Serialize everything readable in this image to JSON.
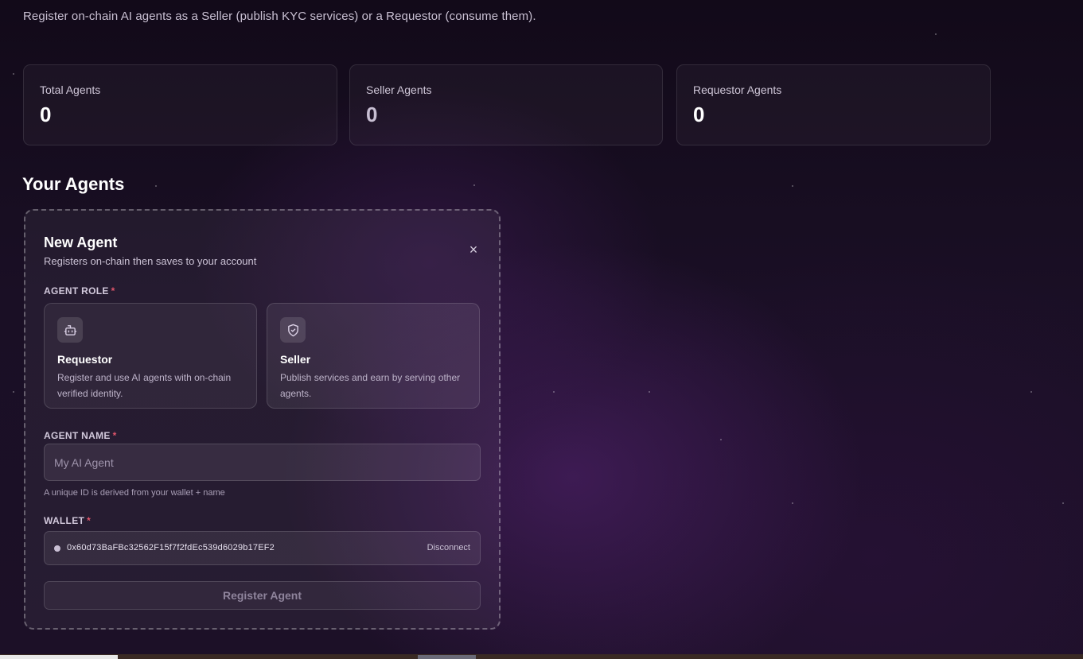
{
  "header": {
    "subtitle": "Register on-chain AI agents as a Seller (publish KYC services) or a Requestor (consume them)."
  },
  "stats": [
    {
      "label": "Total Agents",
      "value": "0"
    },
    {
      "label": "Seller Agents",
      "value": "0"
    },
    {
      "label": "Requestor Agents",
      "value": "0"
    }
  ],
  "section": {
    "title": "Your Agents"
  },
  "new_agent": {
    "title": "New Agent",
    "description": "Registers on-chain then saves to your account",
    "close_symbol": "×",
    "role_label": "AGENT ROLE",
    "required_mark": "*",
    "roles": [
      {
        "name": "Requestor",
        "description": "Register and use AI agents with on-chain verified identity.",
        "icon": "robot-icon"
      },
      {
        "name": "Seller",
        "description": "Publish services and earn by serving other agents.",
        "icon": "shield-check-icon"
      }
    ],
    "name_label": "AGENT NAME",
    "name_placeholder": "My AI Agent",
    "name_value": "",
    "name_hint": "A unique ID is derived from your wallet + name",
    "wallet_label": "WALLET",
    "wallet_address": "0x60d73BaFBc32562F15f7f2fdEc539d6029b17EF2",
    "disconnect_label": "Disconnect",
    "submit_label": "Register Agent"
  }
}
